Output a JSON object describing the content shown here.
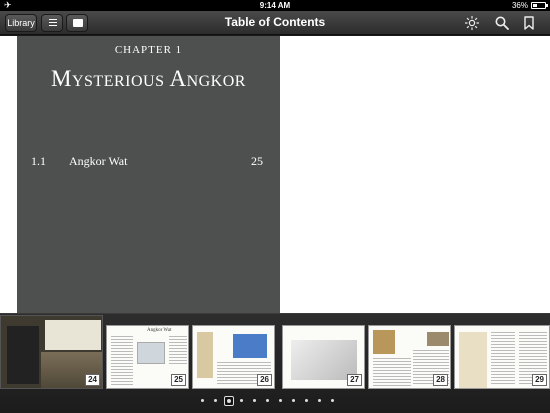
{
  "status_bar": {
    "time": "9:14 AM",
    "battery": "36%",
    "battery_level": 0.36
  },
  "toolbar": {
    "library_label": "Library",
    "title": "Table of Contents"
  },
  "chapter": {
    "label": "CHAPTER 1",
    "title": "Mysterious Angkor",
    "entries": [
      {
        "number": "1.1",
        "name": "Angkor Wat",
        "page": "25"
      }
    ]
  },
  "filmstrip": {
    "pages": [
      "24",
      "25",
      "26",
      "27",
      "28",
      "29"
    ],
    "thumb_texts": {
      "25": "Angkor Wat"
    },
    "current_page": "24",
    "dot_count": 11,
    "active_dot": 2
  }
}
